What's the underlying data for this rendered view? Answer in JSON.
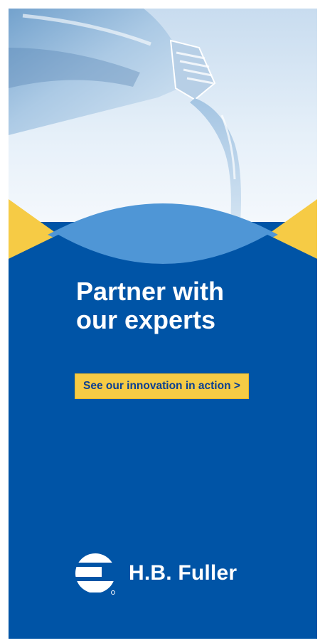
{
  "ad": {
    "headline_line1": "Partner with",
    "headline_line2": "our experts",
    "cta_label": "See our innovation in action >",
    "brand_name": "H.B. Fuller",
    "image": "water-pouring-from-bottle",
    "logo_icon": "hb-fuller-logo-mark"
  },
  "colors": {
    "background_blue": "#0054a6",
    "wave_light_blue": "#4f96d6",
    "accent_yellow": "#f6cb45",
    "cta_text": "#0a3f91",
    "text_white": "#ffffff"
  }
}
